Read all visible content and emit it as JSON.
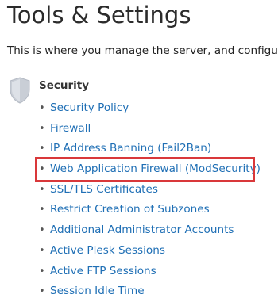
{
  "page": {
    "title": "Tools & Settings",
    "subtitle": "This is where you manage the server, and configure"
  },
  "section": {
    "title": "Security",
    "icon": "shield-icon",
    "bullet": "•",
    "items": [
      {
        "label": "Security Policy"
      },
      {
        "label": "Firewall"
      },
      {
        "label": "IP Address Banning (Fail2Ban)"
      },
      {
        "label": "Web Application Firewall (ModSecurity)",
        "highlighted": true
      },
      {
        "label": "SSL/TLS Certificates"
      },
      {
        "label": "Restrict Creation of Subzones"
      },
      {
        "label": "Additional Administrator Accounts"
      },
      {
        "label": "Active Plesk Sessions"
      },
      {
        "label": "Active FTP Sessions"
      },
      {
        "label": "Session Idle Time"
      }
    ]
  },
  "colors": {
    "link": "#1f6fb5",
    "highlight_border": "#d9383a",
    "shield_fill": "#c9ced6"
  }
}
